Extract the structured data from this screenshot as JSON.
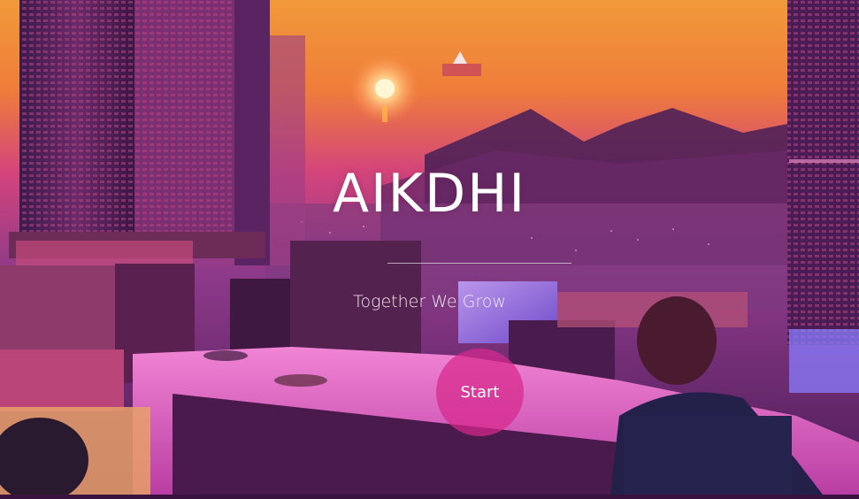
{
  "hero": {
    "title": "AIKDHI",
    "tagline": "Together We Grow",
    "start_label": "Start"
  },
  "colors": {
    "sky_top": "#e87a36",
    "sky_mid": "#d2407a",
    "accent_button": "#d7288c",
    "desk_surface": "#e76fc7",
    "building_dark": "#3b1448"
  }
}
